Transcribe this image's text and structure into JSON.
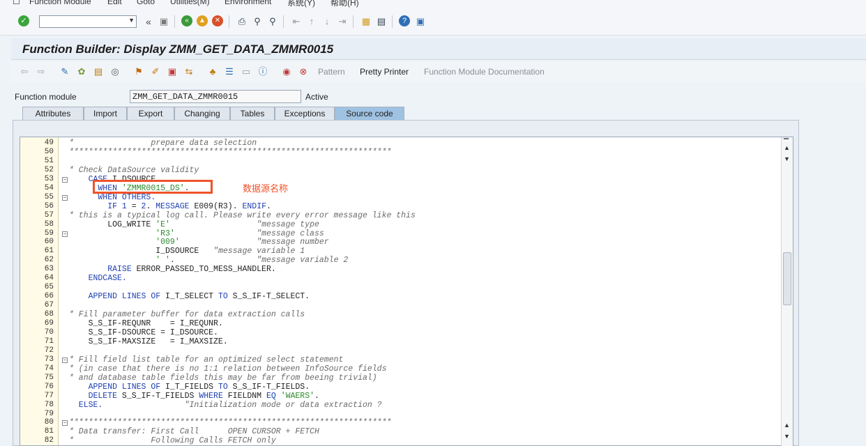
{
  "menu": [
    "Function Module",
    "Edit",
    "Goto",
    "Utilities(M)",
    "Environment",
    "系统(Y)",
    "帮助(H)"
  ],
  "title": "Function Builder: Display ZMM_GET_DATA_ZMMR0015",
  "app_toolbar": {
    "pattern": "Pattern",
    "pretty_printer": "Pretty Printer",
    "fm_doc": "Function Module Documentation"
  },
  "field": {
    "label": "Function module",
    "value": "ZMM_GET_DATA_ZMMR0015",
    "status": "Active"
  },
  "tabs": [
    "Attributes",
    "Import",
    "Export",
    "Changing",
    "Tables",
    "Exceptions",
    "Source code"
  ],
  "active_tab": "Source code",
  "annotation": "数据源名称",
  "colors": {
    "accent": "#f0522a",
    "keyword": "#1e3fb0",
    "string": "#2c8a2c",
    "comment": "#6a6a6a",
    "active_tab": "#9fc2e2"
  },
  "icons": [
    "enter-icon",
    "back-icon",
    "save-icon",
    "green-back-icon",
    "exit-icon",
    "cancel-icon",
    "print-icon",
    "find-icon",
    "find-next-icon",
    "first-page-icon",
    "prev-page-icon",
    "next-page-icon",
    "last-page-icon",
    "create-session-icon",
    "shortcut-icon",
    "help-icon",
    "customize-icon"
  ],
  "lines": [
    {
      "n": "49",
      "fold": false,
      "segs": [
        {
          "c": "com",
          "t": "*                prepare data selection"
        }
      ]
    },
    {
      "n": "50",
      "fold": false,
      "segs": [
        {
          "c": "com",
          "t": "*******************************************************************"
        }
      ]
    },
    {
      "n": "51",
      "fold": false,
      "segs": []
    },
    {
      "n": "52",
      "fold": false,
      "segs": [
        {
          "c": "com",
          "t": "* Check DataSource validity"
        }
      ]
    },
    {
      "n": "53",
      "fold": true,
      "segs": [
        {
          "c": "kw",
          "t": "    CASE"
        },
        {
          "c": "",
          "t": " I_DSOURCE."
        }
      ]
    },
    {
      "n": "54",
      "fold": false,
      "segs": [
        {
          "c": "kw",
          "t": "      WHEN"
        },
        {
          "c": "",
          "t": " "
        },
        {
          "c": "str",
          "t": "'ZMMR0015_DS'"
        },
        {
          "c": "",
          "t": "."
        }
      ]
    },
    {
      "n": "55",
      "fold": true,
      "segs": [
        {
          "c": "kw",
          "t": "      WHEN OTHERS."
        }
      ]
    },
    {
      "n": "56",
      "fold": false,
      "segs": [
        {
          "c": "kw",
          "t": "        IF"
        },
        {
          "c": "",
          "t": " "
        },
        {
          "c": "num",
          "t": "1"
        },
        {
          "c": "",
          "t": " = "
        },
        {
          "c": "num",
          "t": "2"
        },
        {
          "c": "",
          "t": ". "
        },
        {
          "c": "kw",
          "t": "MESSAGE"
        },
        {
          "c": "",
          "t": " E009(R3). "
        },
        {
          "c": "kw",
          "t": "ENDIF"
        },
        {
          "c": "",
          "t": "."
        }
      ]
    },
    {
      "n": "57",
      "fold": false,
      "segs": [
        {
          "c": "com",
          "t": "* this is a typical log call. Please write every error message like this"
        }
      ]
    },
    {
      "n": "58",
      "fold": false,
      "segs": [
        {
          "c": "",
          "t": "        LOG_WRITE "
        },
        {
          "c": "str",
          "t": "'E'"
        },
        {
          "c": "com",
          "t": "                  \"message type"
        }
      ]
    },
    {
      "n": "59",
      "fold": true,
      "segs": [
        {
          "c": "str",
          "t": "                  'R3'"
        },
        {
          "c": "com",
          "t": "                 \"message class"
        }
      ]
    },
    {
      "n": "60",
      "fold": false,
      "segs": [
        {
          "c": "str",
          "t": "                  '009'"
        },
        {
          "c": "com",
          "t": "                \"message number"
        }
      ]
    },
    {
      "n": "61",
      "fold": false,
      "segs": [
        {
          "c": "",
          "t": "                  I_DSOURCE   "
        },
        {
          "c": "com",
          "t": "\"message variable 1"
        }
      ]
    },
    {
      "n": "62",
      "fold": false,
      "segs": [
        {
          "c": "str",
          "t": "                  ' '"
        },
        {
          "c": "",
          "t": "."
        },
        {
          "c": "com",
          "t": "                 \"message variable 2"
        }
      ]
    },
    {
      "n": "63",
      "fold": false,
      "segs": [
        {
          "c": "kw",
          "t": "        RAISE"
        },
        {
          "c": "",
          "t": " ERROR_PASSED_TO_MESS_HANDLER."
        }
      ]
    },
    {
      "n": "64",
      "fold": false,
      "segs": [
        {
          "c": "kw",
          "t": "    ENDCASE."
        }
      ]
    },
    {
      "n": "65",
      "fold": false,
      "segs": []
    },
    {
      "n": "66",
      "fold": false,
      "segs": [
        {
          "c": "kw",
          "t": "    APPEND LINES OF"
        },
        {
          "c": "",
          "t": " I_T_SELECT "
        },
        {
          "c": "kw",
          "t": "TO"
        },
        {
          "c": "",
          "t": " S_S_IF-T_SELECT."
        }
      ]
    },
    {
      "n": "67",
      "fold": false,
      "segs": []
    },
    {
      "n": "68",
      "fold": false,
      "segs": [
        {
          "c": "com",
          "t": "* Fill parameter buffer for data extraction calls"
        }
      ]
    },
    {
      "n": "69",
      "fold": false,
      "segs": [
        {
          "c": "",
          "t": "    S_S_IF-REQUNR    = I_REQUNR."
        }
      ]
    },
    {
      "n": "70",
      "fold": false,
      "segs": [
        {
          "c": "",
          "t": "    S_S_IF-DSOURCE = I_DSOURCE."
        }
      ]
    },
    {
      "n": "71",
      "fold": false,
      "segs": [
        {
          "c": "",
          "t": "    S_S_IF-MAXSIZE   = I_MAXSIZE."
        }
      ]
    },
    {
      "n": "72",
      "fold": false,
      "segs": []
    },
    {
      "n": "73",
      "fold": true,
      "segs": [
        {
          "c": "com",
          "t": "* Fill field list table for an optimized select statement"
        }
      ]
    },
    {
      "n": "74",
      "fold": false,
      "segs": [
        {
          "c": "com",
          "t": "* (in case that there is no 1:1 relation between InfoSource fields"
        }
      ]
    },
    {
      "n": "75",
      "fold": false,
      "segs": [
        {
          "c": "com",
          "t": "* and database table fields this may be far from beeing trivial)"
        }
      ]
    },
    {
      "n": "76",
      "fold": false,
      "segs": [
        {
          "c": "kw",
          "t": "    APPEND LINES OF"
        },
        {
          "c": "",
          "t": " I_T_FIELDS "
        },
        {
          "c": "kw",
          "t": "TO"
        },
        {
          "c": "",
          "t": " S_S_IF-T_FIELDS."
        }
      ]
    },
    {
      "n": "77",
      "fold": false,
      "segs": [
        {
          "c": "kw",
          "t": "    DELETE"
        },
        {
          "c": "",
          "t": " S_S_IF-T_FIELDS "
        },
        {
          "c": "kw",
          "t": "WHERE"
        },
        {
          "c": "",
          "t": " FIELDNM "
        },
        {
          "c": "kw",
          "t": "EQ"
        },
        {
          "c": "",
          "t": " "
        },
        {
          "c": "str",
          "t": "'WAERS'"
        },
        {
          "c": "",
          "t": "."
        }
      ]
    },
    {
      "n": "78",
      "fold": false,
      "segs": [
        {
          "c": "kw",
          "t": "  ELSE."
        },
        {
          "c": "com",
          "t": "                 \"Initialization mode or data extraction ?"
        }
      ]
    },
    {
      "n": "79",
      "fold": false,
      "segs": []
    },
    {
      "n": "80",
      "fold": true,
      "segs": [
        {
          "c": "com",
          "t": "*******************************************************************"
        }
      ]
    },
    {
      "n": "81",
      "fold": false,
      "segs": [
        {
          "c": "com",
          "t": "* Data transfer: First Call      OPEN CURSOR + FETCH"
        }
      ]
    },
    {
      "n": "82",
      "fold": false,
      "segs": [
        {
          "c": "com",
          "t": "*                Following Calls FETCH only"
        }
      ]
    }
  ]
}
